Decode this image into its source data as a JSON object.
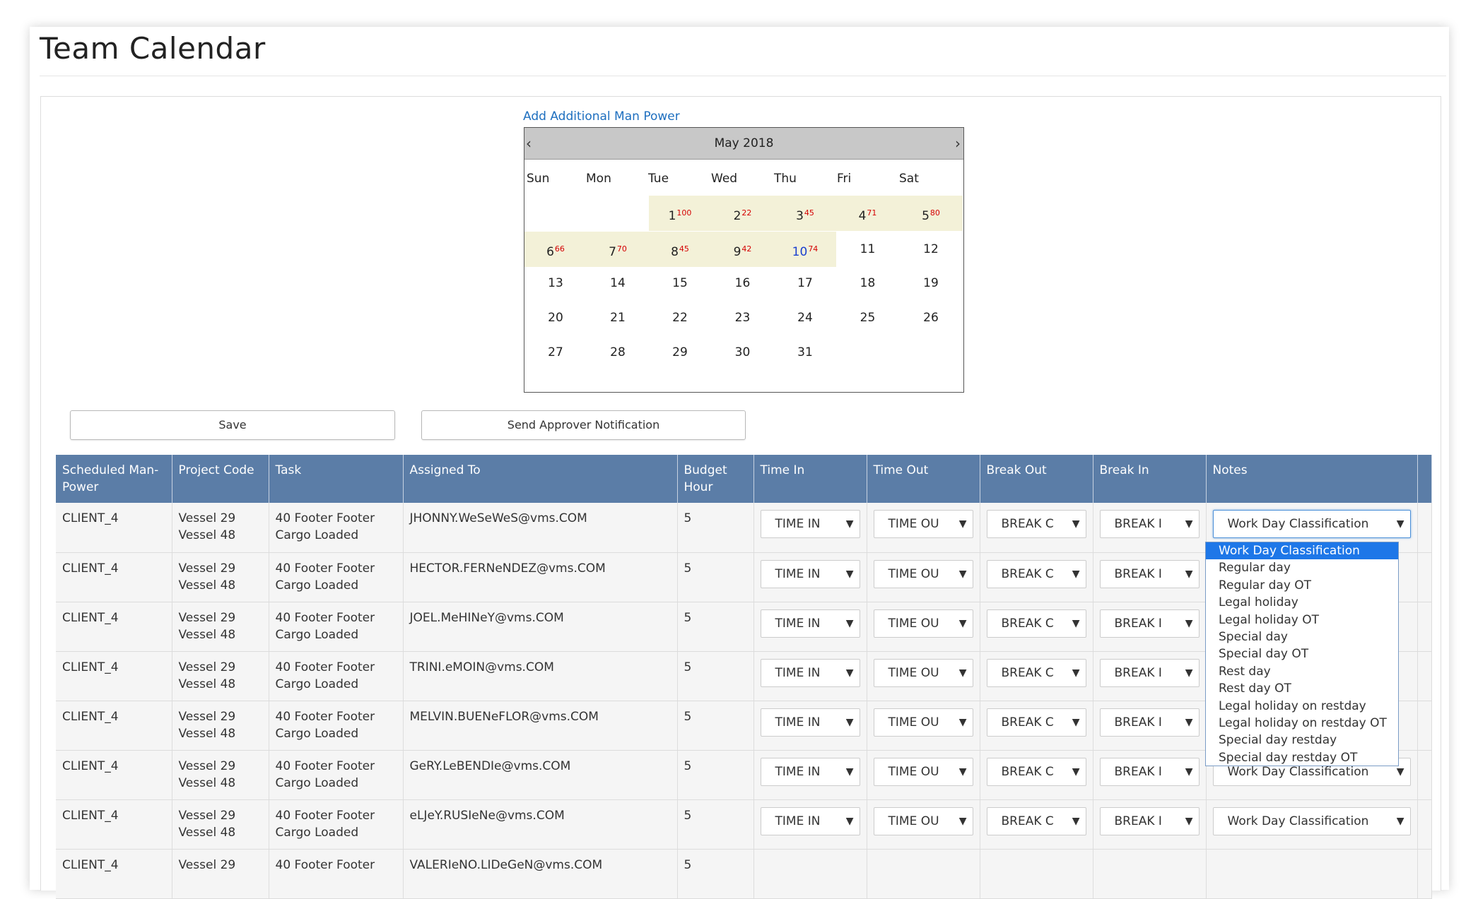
{
  "page": {
    "title": "Team Calendar"
  },
  "add_link": "Add Additional Man Power",
  "calendar": {
    "month_label": "May 2018",
    "prev": "‹",
    "next": "›",
    "weekdays": [
      "Sun",
      "Mon",
      "Tue",
      "Wed",
      "Thu",
      "Fri",
      "Sat"
    ],
    "days": [
      {
        "day": "1",
        "count": "100",
        "highlight": true
      },
      {
        "day": "2",
        "count": "22",
        "highlight": true
      },
      {
        "day": "3",
        "count": "45",
        "highlight": true
      },
      {
        "day": "4",
        "count": "71",
        "highlight": true
      },
      {
        "day": "5",
        "count": "80",
        "highlight": true
      },
      {
        "day": "6",
        "count": "66",
        "highlight": true
      },
      {
        "day": "7",
        "count": "70",
        "highlight": true
      },
      {
        "day": "8",
        "count": "45",
        "highlight": true
      },
      {
        "day": "9",
        "count": "42",
        "highlight": true
      },
      {
        "day": "10",
        "count": "74",
        "highlight": true,
        "blue": true
      },
      {
        "day": "11"
      },
      {
        "day": "12"
      },
      {
        "day": "13"
      },
      {
        "day": "14"
      },
      {
        "day": "15"
      },
      {
        "day": "16"
      },
      {
        "day": "17"
      },
      {
        "day": "18"
      },
      {
        "day": "19"
      },
      {
        "day": "20"
      },
      {
        "day": "21"
      },
      {
        "day": "22"
      },
      {
        "day": "23"
      },
      {
        "day": "24"
      },
      {
        "day": "25"
      },
      {
        "day": "26"
      },
      {
        "day": "27"
      },
      {
        "day": "28"
      },
      {
        "day": "29"
      },
      {
        "day": "30"
      },
      {
        "day": "31"
      }
    ]
  },
  "buttons": {
    "save": "Save",
    "send": "Send Approver Notification"
  },
  "table": {
    "headers": [
      "Scheduled Man-Power",
      "Project Code",
      "Task",
      "Assigned To",
      "Budget Hour",
      "Time In",
      "Time Out",
      "Break Out",
      "Break In",
      "Notes"
    ],
    "rows": [
      {
        "client": "CLIENT_4",
        "project": [
          "Vessel 29",
          "Vessel 48"
        ],
        "task": [
          "40 Footer Footer",
          "Cargo Loaded"
        ],
        "assigned": "JHONNY.WeSeWeS@vms.COM",
        "budget": "5",
        "time_in": "TIME IN",
        "time_out": "TIME OU",
        "break_out": "BREAK C",
        "break_in": "BREAK I",
        "notes": "Work Day Classification"
      },
      {
        "client": "CLIENT_4",
        "project": [
          "Vessel 29",
          "Vessel 48"
        ],
        "task": [
          "40 Footer Footer",
          "Cargo Loaded"
        ],
        "assigned": "HECTOR.FERNeNDEZ@vms.COM",
        "budget": "5",
        "time_in": "TIME IN",
        "time_out": "TIME OU",
        "break_out": "BREAK C",
        "break_in": "BREAK I",
        "notes": ""
      },
      {
        "client": "CLIENT_4",
        "project": [
          "Vessel 29",
          "Vessel 48"
        ],
        "task": [
          "40 Footer Footer",
          "Cargo Loaded"
        ],
        "assigned": "JOEL.MeHINeY@vms.COM",
        "budget": "5",
        "time_in": "TIME IN",
        "time_out": "TIME OU",
        "break_out": "BREAK C",
        "break_in": "BREAK I",
        "notes": ""
      },
      {
        "client": "CLIENT_4",
        "project": [
          "Vessel 29",
          "Vessel 48"
        ],
        "task": [
          "40 Footer Footer",
          "Cargo Loaded"
        ],
        "assigned": "TRINI.eMOIN@vms.COM",
        "budget": "5",
        "time_in": "TIME IN",
        "time_out": "TIME OU",
        "break_out": "BREAK C",
        "break_in": "BREAK I",
        "notes": ""
      },
      {
        "client": "CLIENT_4",
        "project": [
          "Vessel 29",
          "Vessel 48"
        ],
        "task": [
          "40 Footer Footer",
          "Cargo Loaded"
        ],
        "assigned": "MELVIN.BUENeFLOR@vms.COM",
        "budget": "5",
        "time_in": "TIME IN",
        "time_out": "TIME OU",
        "break_out": "BREAK C",
        "break_in": "BREAK I",
        "notes": ""
      },
      {
        "client": "CLIENT_4",
        "project": [
          "Vessel 29",
          "Vessel 48"
        ],
        "task": [
          "40 Footer Footer",
          "Cargo Loaded"
        ],
        "assigned": "GeRY.LeBENDIe@vms.COM",
        "budget": "5",
        "time_in": "TIME IN",
        "time_out": "TIME OU",
        "break_out": "BREAK C",
        "break_in": "BREAK I",
        "notes": "Work Day Classification"
      },
      {
        "client": "CLIENT_4",
        "project": [
          "Vessel 29",
          "Vessel 48"
        ],
        "task": [
          "40 Footer Footer",
          "Cargo Loaded"
        ],
        "assigned": "eLJeY.RUSIeNe@vms.COM",
        "budget": "5",
        "time_in": "TIME IN",
        "time_out": "TIME OU",
        "break_out": "BREAK C",
        "break_in": "BREAK I",
        "notes": "Work Day Classification"
      },
      {
        "client": "CLIENT_4",
        "project": [
          "Vessel 29",
          ""
        ],
        "task": [
          "40 Footer Footer",
          ""
        ],
        "assigned": "VALERIeNO.LIDeGeN@vms.COM",
        "budget": "5",
        "time_in": "",
        "time_out": "",
        "break_out": "",
        "break_in": "",
        "notes": ""
      }
    ]
  },
  "notes_dropdown": {
    "options": [
      "Work Day Classification",
      "Regular day",
      "Regular day OT",
      "Legal holiday",
      "Legal holiday OT",
      "Special day",
      "Special day OT",
      "Rest day",
      "Rest day OT",
      "Legal holiday on restday",
      "Legal holiday on restday OT",
      "Special day restday",
      "Special day restday OT"
    ],
    "selected_index": 0
  },
  "colors": {
    "header_bg": "#5b7da7",
    "highlight_day": "#f3f1d8",
    "count_red": "#d40000",
    "dropdown_selected": "#1e77e8",
    "link_blue": "#1e6fbf"
  },
  "icons": {
    "select_arrow": "triangle-down-icon",
    "prev": "chevron-left-icon",
    "next": "chevron-right-icon"
  }
}
